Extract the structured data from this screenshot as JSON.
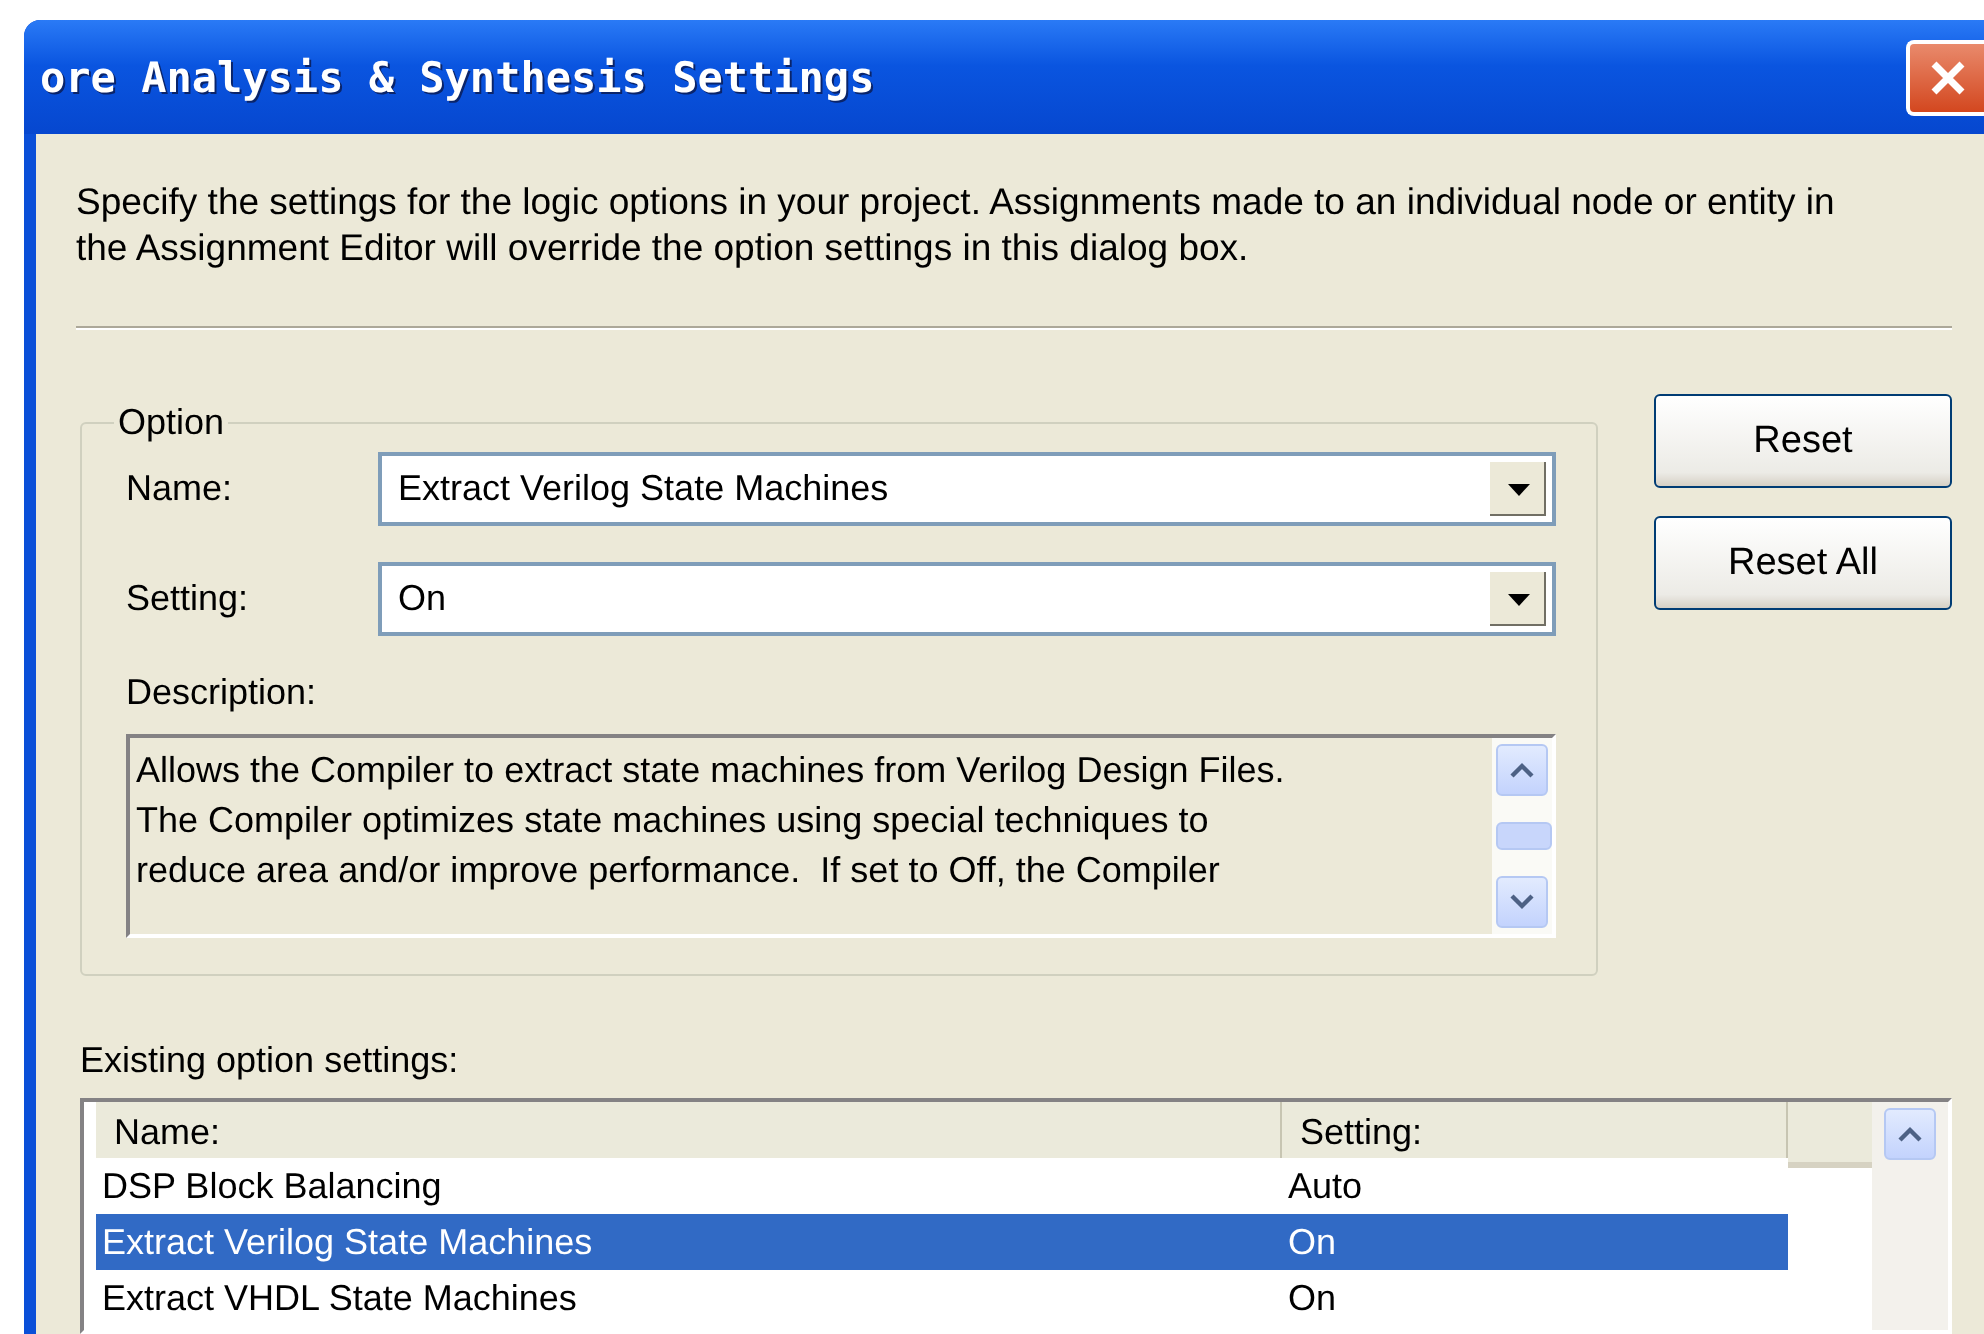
{
  "window": {
    "title": "ore Analysis & Synthesis Settings"
  },
  "intro": "Specify the settings for the logic options in your project.  Assignments made to an individual node or entity in the Assignment Editor will override the option settings in this dialog box.",
  "option_group": {
    "title": "Option",
    "name_field": {
      "label": "Name:",
      "value": "Extract Verilog State Machines"
    },
    "setting_field": {
      "label": "Setting:",
      "value": "On"
    },
    "description": {
      "label": "Description:",
      "text": "Allows the Compiler to extract state machines from Verilog Design Files.\nThe Compiler optimizes state machines using special techniques to\nreduce area and/or improve performance.  If set to Off, the Compiler"
    }
  },
  "buttons": [
    {
      "label": "Reset"
    },
    {
      "label": "Reset All"
    }
  ],
  "existing": {
    "label": "Existing option settings:",
    "columns": [
      "Name:",
      "Setting:"
    ],
    "rows": [
      {
        "name": "DSP Block Balancing",
        "setting": "Auto",
        "selected": false
      },
      {
        "name": "Extract Verilog State Machines",
        "setting": "On",
        "selected": true
      },
      {
        "name": "Extract VHDL State Machines",
        "setting": "On",
        "selected": false
      }
    ]
  }
}
